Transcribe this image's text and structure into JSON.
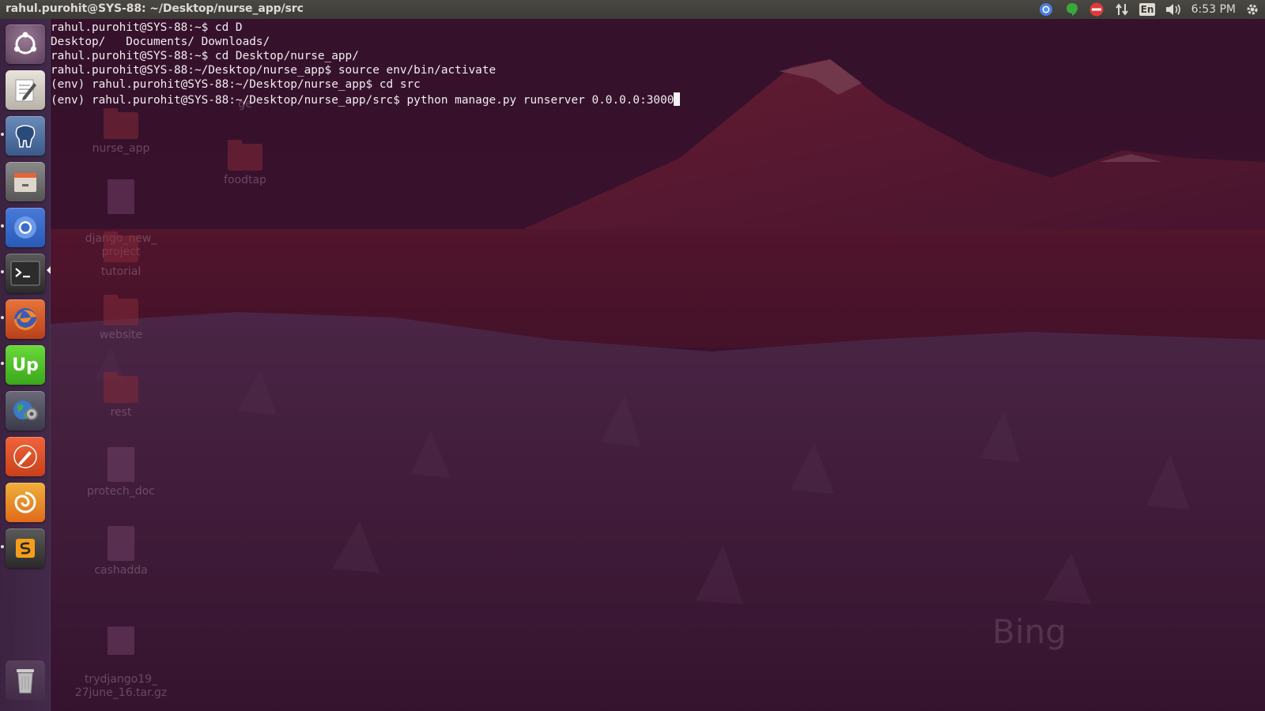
{
  "window": {
    "title": "rahul.purohit@SYS-88: ~/Desktop/nurse_app/src"
  },
  "panel": {
    "indicators": [
      "chromium-icon",
      "hangouts-icon",
      "do-not-disturb-icon",
      "network-arrows-icon",
      "keyboard-layout-icon",
      "volume-icon"
    ],
    "keyboard_layout": "En",
    "clock": "6:53 PM"
  },
  "launcher": {
    "items": [
      {
        "name": "dash-home-icon"
      },
      {
        "name": "text-editor-icon"
      },
      {
        "name": "pgadmin-elephant-icon"
      },
      {
        "name": "files-icon"
      },
      {
        "name": "chromium-icon"
      },
      {
        "name": "terminal-icon"
      },
      {
        "name": "firefox-icon"
      },
      {
        "name": "upwork-icon"
      },
      {
        "name": "system-settings-globe-icon"
      },
      {
        "name": "postman-pen-icon"
      },
      {
        "name": "swirl-app-icon"
      },
      {
        "name": "sublime-text-icon"
      },
      {
        "name": "trash-icon"
      }
    ]
  },
  "desktop": {
    "icons": [
      {
        "label": "ge",
        "type": "folder"
      },
      {
        "label": "nurse_app",
        "type": "folder"
      },
      {
        "label": "foodtap",
        "type": "folder"
      },
      {
        "label": "django_new_\nproject",
        "type": "doc"
      },
      {
        "label": "tutorial",
        "type": "folder"
      },
      {
        "label": "website",
        "type": "folder"
      },
      {
        "label": "rest",
        "type": "folder"
      },
      {
        "label": "protech_doc",
        "type": "doc"
      },
      {
        "label": "cashadda",
        "type": "doc"
      },
      {
        "label": "trydjango19_\n27june_16.tar.gz",
        "type": "doc"
      }
    ],
    "watermark": "Bing"
  },
  "terminal": {
    "lines": [
      "rahul.purohit@SYS-88:~$ cd D",
      "Desktop/   Documents/ Downloads/",
      "rahul.purohit@SYS-88:~$ cd Desktop/nurse_app/",
      "rahul.purohit@SYS-88:~/Desktop/nurse_app$ source env/bin/activate",
      "(env) rahul.purohit@SYS-88:~/Desktop/nurse_app$ cd src",
      "(env) rahul.purohit@SYS-88:~/Desktop/nurse_app/src$ python manage.py runserver 0.0.0.0:3000"
    ]
  },
  "colors": {
    "panel_bg": "#3c3b37",
    "terminal_text": "#f0eef0",
    "ubuntu_orange": "#dd4814"
  }
}
